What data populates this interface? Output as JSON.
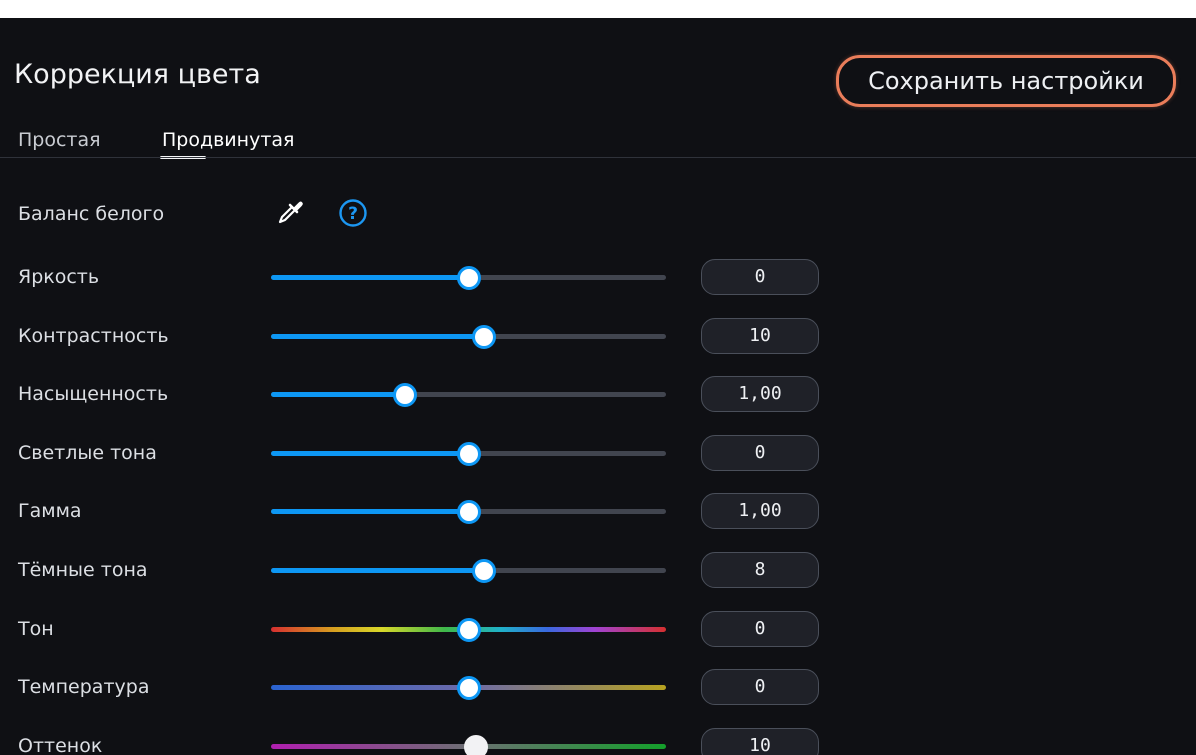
{
  "title": "Коррекция цвета",
  "save_button": "Сохранить настройки",
  "tabs": [
    {
      "label": "Простая",
      "active": false
    },
    {
      "label": "Продвинутая",
      "active": true
    }
  ],
  "white_balance": {
    "label": "Баланс белого",
    "icons": [
      "eyedropper-icon",
      "help-icon"
    ],
    "help_glyph": "?"
  },
  "colors": {
    "accent": "#0d97f4",
    "save_outline": "#ea7d5a",
    "background": "#0f1014"
  },
  "sliders": [
    {
      "label": "Яркость",
      "value": "0",
      "position_pct": 50,
      "style": "blue"
    },
    {
      "label": "Контрастность",
      "value": "10",
      "position_pct": 54,
      "style": "blue"
    },
    {
      "label": "Насыщенность",
      "value": "1,00",
      "position_pct": 34,
      "style": "blue"
    },
    {
      "label": "Светлые тона",
      "value": "0",
      "position_pct": 50,
      "style": "blue"
    },
    {
      "label": "Гамма",
      "value": "1,00",
      "position_pct": 50,
      "style": "blue"
    },
    {
      "label": "Тёмные тона",
      "value": "8",
      "position_pct": 54,
      "style": "blue"
    },
    {
      "label": "Тон",
      "value": "0",
      "position_pct": 50,
      "style": "hue"
    },
    {
      "label": "Температура",
      "value": "0",
      "position_pct": 50,
      "style": "temperature"
    },
    {
      "label": "Оттенок",
      "value": "10",
      "position_pct": 52,
      "style": "tint"
    }
  ]
}
